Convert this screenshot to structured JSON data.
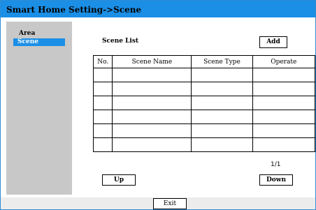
{
  "title": "Smart Home Setting->Scene",
  "sidebar": {
    "items": [
      {
        "label": "Area"
      },
      {
        "label": "Scene"
      }
    ]
  },
  "main": {
    "section_title": "Scene List",
    "add_label": "Add",
    "columns": [
      "No.",
      "Scene Name",
      "Scene Type",
      "Operate"
    ],
    "rows": [
      [
        "",
        "",
        "",
        ""
      ],
      [
        "",
        "",
        "",
        ""
      ],
      [
        "",
        "",
        "",
        ""
      ],
      [
        "",
        "",
        "",
        ""
      ],
      [
        "",
        "",
        "",
        ""
      ],
      [
        "",
        "",
        "",
        ""
      ]
    ],
    "page": "1/1",
    "up_label": "Up",
    "down_label": "Down"
  },
  "footer": {
    "exit_label": "Exit"
  },
  "colors": {
    "accent": "#1b8fe6",
    "sidebar": "#c8c8c8",
    "footer": "#ececec"
  }
}
